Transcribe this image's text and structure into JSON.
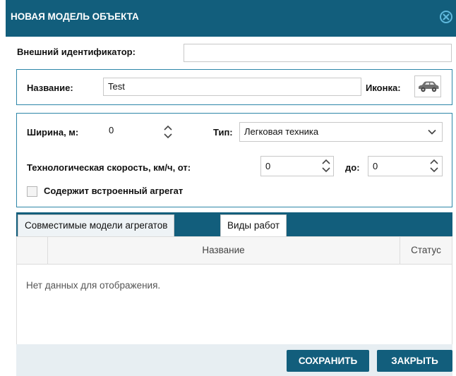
{
  "dialog": {
    "title": "НОВАЯ МОДЕЛЬ ОБЪЕКТА",
    "close_icon": "close-circle-icon"
  },
  "external_id": {
    "label": "Внешний идентификатор:",
    "value": ""
  },
  "name_group": {
    "name_label": "Название:",
    "name_value": "Test",
    "icon_label": "Иконка:",
    "icon_name": "car-icon"
  },
  "params": {
    "width_label": "Ширина, м:",
    "width_value": "0",
    "type_label": "Тип:",
    "type_value": "Легковая техника",
    "speed_label": "Технологическая скорость, км/ч, от:",
    "speed_from": "0",
    "to_label": "до:",
    "speed_to": "0",
    "builtin_label": "Содержит встроенный агрегат",
    "builtin_checked": false
  },
  "tabs": [
    {
      "label": "Совместимые модели агрегатов",
      "active": true
    },
    {
      "label": "Виды работ",
      "active": false
    }
  ],
  "grid": {
    "columns": [
      "",
      "Название",
      "Статус"
    ],
    "empty_text": "Нет данных для отображения."
  },
  "footer": {
    "save_label": "СОХРАНИТЬ",
    "close_label": "ЗАКРЫТЬ"
  },
  "colors": {
    "header": "#125e7c",
    "group_border": "#2d86a8",
    "footer_bg": "#e7eef2"
  }
}
